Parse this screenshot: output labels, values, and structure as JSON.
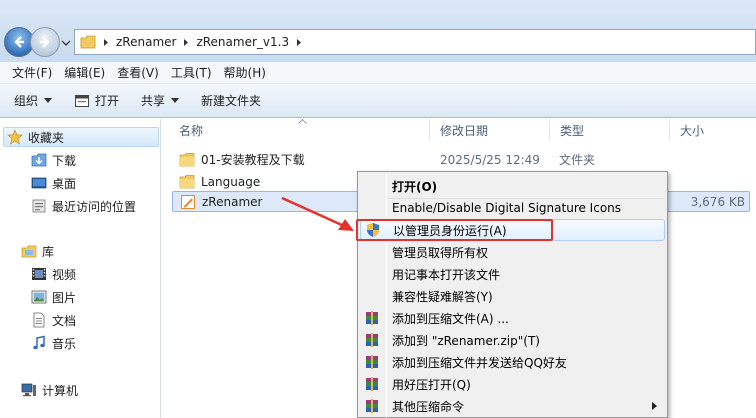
{
  "address": {
    "crumbs": [
      "zRenamer",
      "zRenamer_v1.3"
    ]
  },
  "menubar": {
    "items": [
      "文件(F)",
      "编辑(E)",
      "查看(V)",
      "工具(T)",
      "帮助(H)"
    ]
  },
  "toolbar": {
    "organize": "组织",
    "open": "打开",
    "share": "共享",
    "new_folder": "新建文件夹"
  },
  "navpane": {
    "favorites": "收藏夹",
    "downloads": "下载",
    "desktop": "桌面",
    "recent": "最近访问的位置",
    "libraries": "库",
    "videos": "视频",
    "pictures": "图片",
    "documents": "文档",
    "music": "音乐",
    "computer": "计算机"
  },
  "columns": {
    "name": "名称",
    "date": "修改日期",
    "type": "类型",
    "size": "大小"
  },
  "files": [
    {
      "name": "01-安装教程及下载",
      "date": "2025/5/25 12:49",
      "type": "文件夹",
      "size": ""
    },
    {
      "name": "Language",
      "date": "",
      "type": "",
      "size": ""
    },
    {
      "name": "zRenamer",
      "date": "",
      "type": "",
      "size": "3,676 KB"
    }
  ],
  "context_menu": {
    "items": [
      "打开(O)",
      "Enable/Disable Digital Signature Icons",
      "以管理员身份运行(A)",
      "管理员取得所有权",
      "用记事本打开该文件",
      "兼容性疑难解答(Y)",
      "添加到压缩文件(A) ...",
      "添加到 \"zRenamer.zip\"(T)",
      "添加到压缩文件并发送给QQ好友",
      "用好压打开(Q)",
      "其他压缩命令"
    ]
  },
  "colors": {
    "highlight": "#e5312c",
    "selection": "#dde9f8"
  }
}
